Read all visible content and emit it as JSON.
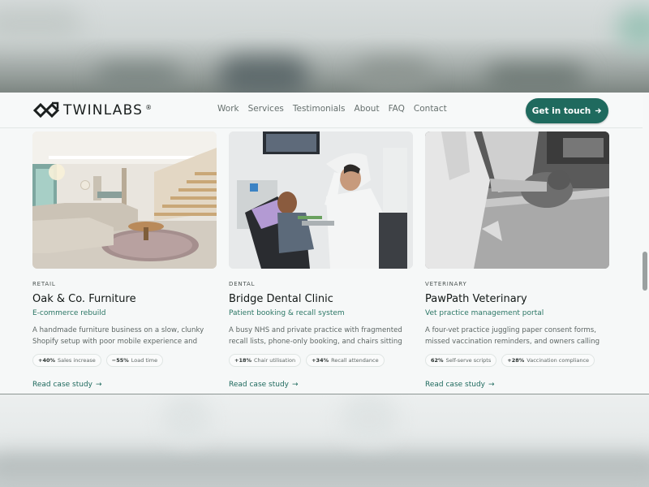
{
  "brand": {
    "name": "TWINLABS",
    "reg_mark": "®"
  },
  "nav": {
    "links": [
      "Work",
      "Services",
      "Testimonials",
      "About",
      "FAQ",
      "Contact"
    ],
    "cta_label": "Get in touch",
    "cta_icon": "arrow-right-icon"
  },
  "colors": {
    "accent": "#1f6a5e",
    "accent_text": "#2b7665",
    "page_bg": "#f6f8f8"
  },
  "cards": [
    {
      "category": "RETAIL",
      "title": "Oak & Co. Furniture",
      "subtitle": "E-commerce rebuild",
      "description": "A handmade furniture business on a slow, clunky Shopify setup with poor mobile experience and high…",
      "stats": [
        {
          "value": "+40%",
          "label": "Sales increase"
        },
        {
          "value": "−55%",
          "label": "Load time"
        }
      ],
      "link": "Read case study",
      "image": "living-room-photo"
    },
    {
      "category": "DENTAL",
      "title": "Bridge Dental Clinic",
      "subtitle": "Patient booking & recall system",
      "description": "A busy NHS and private practice with fragmented recall lists, phone-only booking, and chairs sitting empty…",
      "stats": [
        {
          "value": "+18%",
          "label": "Chair utilisation"
        },
        {
          "value": "+34%",
          "label": "Recall attendance"
        }
      ],
      "link": "Read case study",
      "image": "dental-clinic-photo"
    },
    {
      "category": "VETERINARY",
      "title": "PawPath Veterinary",
      "subtitle": "Vet practice management portal",
      "description": "A four-vet practice juggling paper consent forms, missed vaccination reminders, and owners calling for…",
      "stats": [
        {
          "value": "62%",
          "label": "Self-serve scripts"
        },
        {
          "value": "+28%",
          "label": "Vaccination compliance"
        }
      ],
      "link": "Read case study",
      "image": "veterinary-photo"
    }
  ]
}
